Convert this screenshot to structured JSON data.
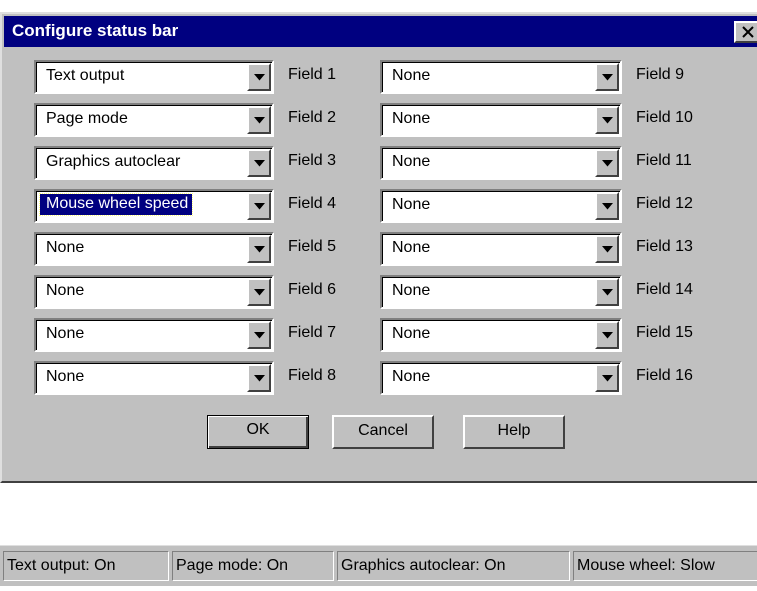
{
  "dialog": {
    "title": "Configure status bar",
    "close_icon": "close-icon",
    "rows": [
      {
        "left_value": "Text output",
        "left_label": "Field 1",
        "right_value": "None",
        "right_label": "Field 9"
      },
      {
        "left_value": "Page mode",
        "left_label": "Field 2",
        "right_value": "None",
        "right_label": "Field 10"
      },
      {
        "left_value": "Graphics autoclear",
        "left_label": "Field 3",
        "right_value": "None",
        "right_label": "Field 11"
      },
      {
        "left_value": "Mouse wheel speed",
        "left_label": "Field 4",
        "right_value": "None",
        "right_label": "Field 12"
      },
      {
        "left_value": "None",
        "left_label": "Field 5",
        "right_value": "None",
        "right_label": "Field 13"
      },
      {
        "left_value": "None",
        "left_label": "Field 6",
        "right_value": "None",
        "right_label": "Field 14"
      },
      {
        "left_value": "None",
        "left_label": "Field 7",
        "right_value": "None",
        "right_label": "Field 15"
      },
      {
        "left_value": "None",
        "left_label": "Field 8",
        "right_value": "None",
        "right_label": "Field 16"
      }
    ],
    "buttons": {
      "ok": "OK",
      "cancel": "Cancel",
      "help": "Help"
    }
  },
  "statusbar": {
    "fields": [
      "Text output: On",
      "Page mode: On",
      "Graphics autoclear: On",
      "Mouse wheel: Slow"
    ]
  },
  "colors": {
    "title_bar": "#000080",
    "face": "#c0c0c0",
    "selection": "#000080"
  }
}
